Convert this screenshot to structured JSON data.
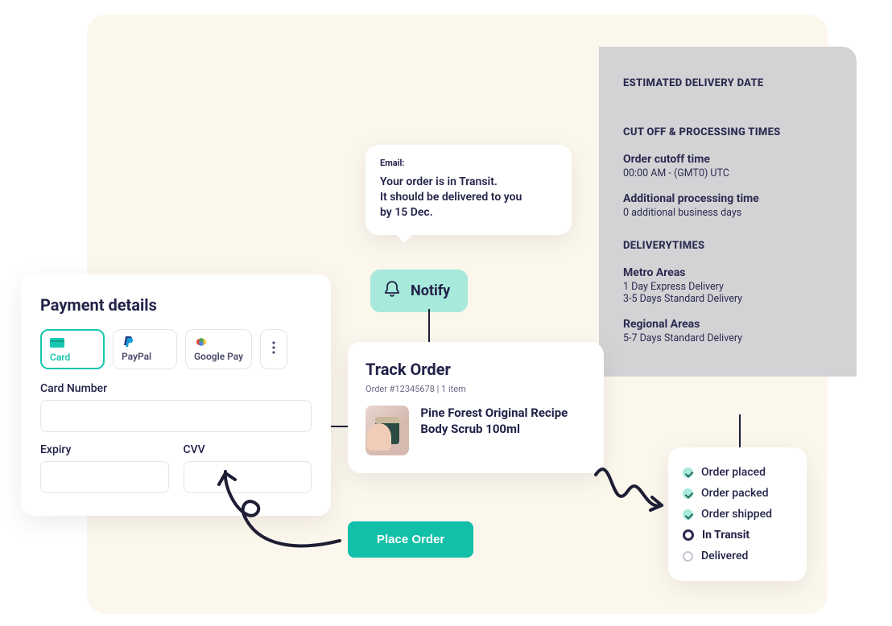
{
  "payment": {
    "title": "Payment details",
    "methods": {
      "card": "Card",
      "paypal": "PayPal",
      "google": "Google Pay"
    },
    "fields": {
      "card_number_label": "Card Number",
      "expiry_label": "Expiry",
      "cvv_label": "CVV"
    }
  },
  "email_tip": {
    "label": "Email:",
    "body_line1": "Your order is in Transit.",
    "body_line2": "It should be delivered to you",
    "body_line3": "by 15 Dec."
  },
  "notify": {
    "label": "Notify"
  },
  "track": {
    "title": "Track Order",
    "order_meta": "Order #12345678  |  1 item",
    "product_name": "Pine Forest Original Recipe Body Scrub 100ml"
  },
  "place_order": {
    "label": "Place Order"
  },
  "delivery": {
    "h1": "ESTIMATED DELIVERY DATE",
    "h2a": "CUT OFF & PROCESSING TIMES",
    "cutoff_label": "Order cutoff time",
    "cutoff_value": "00:00 AM - (GMT0) UTC",
    "proc_label": "Additional processing time",
    "proc_value": "0 additional business days",
    "h2b": "DELIVERYTIMES",
    "metro_label": "Metro Areas",
    "metro_line1": "1 Day Express Delivery",
    "metro_line2": "3-5 Days Standard Delivery",
    "regional_label": "Regional Areas",
    "regional_line1": "5-7 Days Standard Delivery"
  },
  "status": {
    "items": [
      {
        "label": "Order placed",
        "state": "done"
      },
      {
        "label": "Order packed",
        "state": "done"
      },
      {
        "label": "Order shipped",
        "state": "done"
      },
      {
        "label": "In Transit",
        "state": "current"
      },
      {
        "label": "Delivered",
        "state": "pending"
      }
    ]
  }
}
